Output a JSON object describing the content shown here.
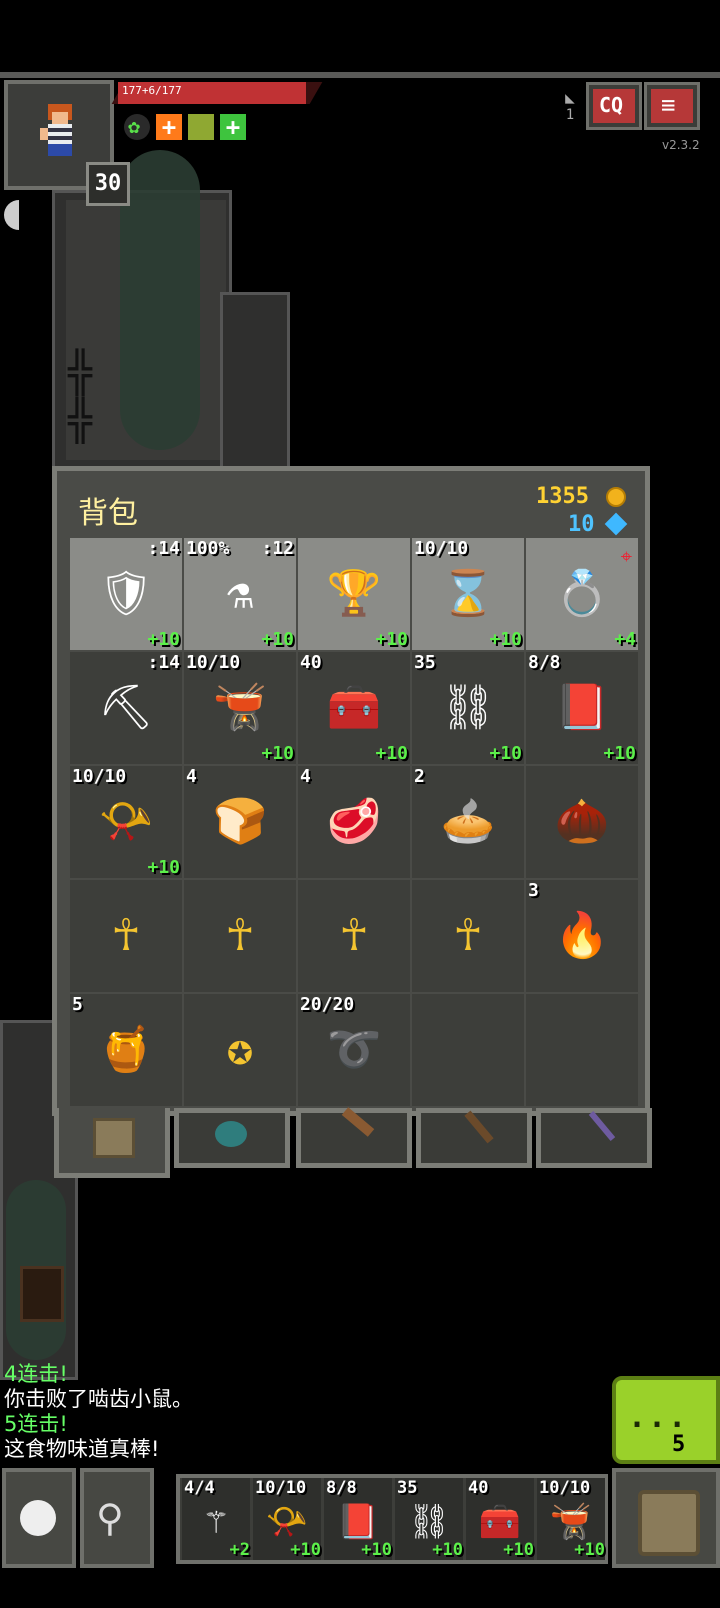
{
  "status": {
    "hp_text": "177+6/177",
    "level": "30",
    "depth": "1",
    "version": "v2.3.2"
  },
  "backpack": {
    "title": "背包",
    "gold": "1355",
    "gems": "10",
    "slots": [
      {
        "icon": "plate-armor-icon",
        "top_left": "",
        "top_right": ":14",
        "top_right2": "",
        "bottom_right": "+10",
        "light": true
      },
      {
        "icon": "brew-icon",
        "top_left": "100%",
        "top_right": ":12",
        "top_right2": "",
        "bottom_right": "+10",
        "light": true
      },
      {
        "icon": "chalice-icon",
        "top_left": "",
        "top_right": "",
        "top_right2": "",
        "bottom_right": "+10",
        "light": true
      },
      {
        "icon": "hourglass-icon",
        "top_left": "10/10",
        "top_right": "",
        "top_right2": "",
        "bottom_right": "+10",
        "light": true
      },
      {
        "icon": "ring-icon",
        "top_left": "",
        "top_right": "",
        "top_right2": "",
        "bottom_right": "+4",
        "light": true
      },
      {
        "icon": "pickaxe-icon",
        "top_left": "",
        "top_right": ":14",
        "top_right2": "",
        "bottom_right": "",
        "light": false
      },
      {
        "icon": "cauldron-icon",
        "top_left": "10/10",
        "top_right": "",
        "top_right2": "",
        "bottom_right": "+10",
        "light": false
      },
      {
        "icon": "alchemist-toolkit-icon",
        "top_left": "40",
        "top_right": "",
        "top_right2": "",
        "bottom_right": "+10",
        "light": false
      },
      {
        "icon": "chains-icon",
        "top_left": "35",
        "top_right": "",
        "top_right2": "",
        "bottom_right": "+10",
        "light": false
      },
      {
        "icon": "spellbook-icon",
        "top_left": "8/8",
        "top_right": "",
        "top_right2": "",
        "bottom_right": "+10",
        "light": false
      },
      {
        "icon": "horn-of-plenty-icon",
        "top_left": "10/10",
        "top_right": "",
        "top_right2": "",
        "bottom_right": "+10",
        "light": false
      },
      {
        "icon": "bread-icon",
        "top_left": "4",
        "top_right": "",
        "top_right2": "",
        "bottom_right": "",
        "light": false
      },
      {
        "icon": "meat-icon",
        "top_left": "4",
        "top_right": "",
        "top_right2": "",
        "bottom_right": "",
        "light": false
      },
      {
        "icon": "pie-icon",
        "top_left": "2",
        "top_right": "",
        "top_right2": "",
        "bottom_right": "",
        "light": false
      },
      {
        "icon": "seed-icon",
        "top_left": "",
        "top_right": "",
        "top_right2": "",
        "bottom_right": "",
        "light": false
      },
      {
        "icon": "ankh-icon",
        "top_left": "",
        "top_right": "",
        "top_right2": "",
        "bottom_right": "",
        "light": false
      },
      {
        "icon": "ankh-icon",
        "top_left": "",
        "top_right": "",
        "top_right2": "",
        "bottom_right": "",
        "light": false
      },
      {
        "icon": "ankh-icon",
        "top_left": "",
        "top_right": "",
        "top_right2": "",
        "bottom_right": "",
        "light": false
      },
      {
        "icon": "ankh-icon",
        "top_left": "",
        "top_right": "",
        "top_right2": "",
        "bottom_right": "",
        "light": false
      },
      {
        "icon": "torch-icon",
        "top_left": "3",
        "top_right": "",
        "top_right2": "",
        "bottom_right": "",
        "light": false
      },
      {
        "icon": "honey-pot-icon",
        "top_left": "5",
        "top_right": "",
        "top_right2": "",
        "bottom_right": "",
        "light": false
      },
      {
        "icon": "amulet-icon",
        "top_left": "",
        "top_right": "",
        "top_right2": "",
        "bottom_right": "",
        "light": false
      },
      {
        "icon": "ethereal-chains-icon",
        "top_left": "20/20",
        "top_right": "",
        "top_right2": "",
        "bottom_right": "",
        "light": false
      },
      {
        "icon": "",
        "top_left": "",
        "top_right": "",
        "top_right2": "",
        "bottom_right": "",
        "light": false
      },
      {
        "icon": "",
        "top_left": "",
        "top_right": "",
        "top_right2": "",
        "bottom_right": "",
        "light": false
      }
    ],
    "tabs": [
      "backpack-tab-icon",
      "pouch-tab-icon",
      "holder-tab-icon",
      "quiver-tab-icon",
      "wand-tab-icon"
    ]
  },
  "log": [
    {
      "text": "4连击!",
      "color": "green"
    },
    {
      "text": "你击败了啮齿小鼠。",
      "color": "white"
    },
    {
      "text": "5连击!",
      "color": "green"
    },
    {
      "text": "这食物味道真棒!",
      "color": "white"
    }
  ],
  "action": {
    "dots": "...",
    "count": "5"
  },
  "quickslots": [
    {
      "icon": "staff-icon",
      "top_left": "4/4",
      "bottom_right": "+2"
    },
    {
      "icon": "horn-of-plenty-icon",
      "top_left": "10/10",
      "bottom_right": "+10"
    },
    {
      "icon": "spellbook-icon",
      "top_left": "8/8",
      "bottom_right": "+10"
    },
    {
      "icon": "chains-icon",
      "top_left": "35",
      "bottom_right": "+10"
    },
    {
      "icon": "alchemist-toolkit-icon",
      "top_left": "40",
      "bottom_right": "+10"
    },
    {
      "icon": "cauldron-icon",
      "top_left": "10/10",
      "bottom_right": "+10"
    }
  ]
}
